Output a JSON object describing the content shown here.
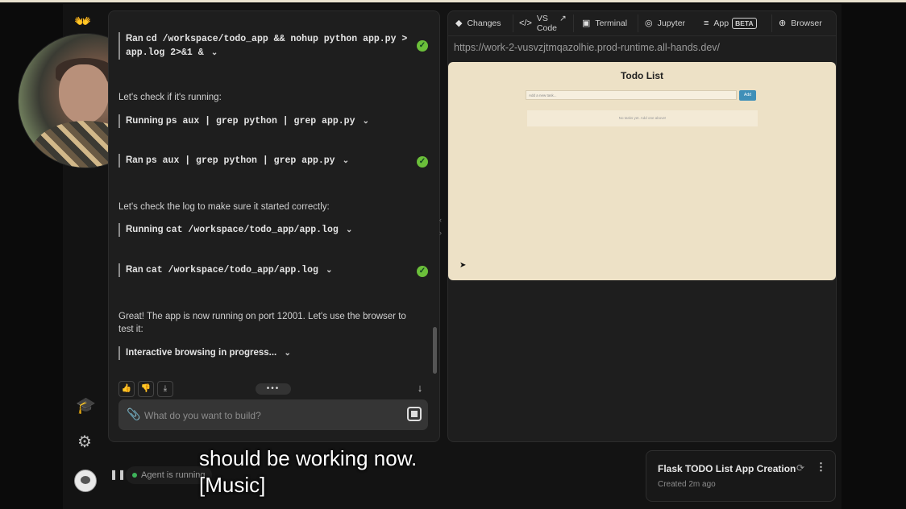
{
  "rail": {
    "logo": "👐"
  },
  "chat": {
    "steps": [
      {
        "kind": "cmd",
        "prefix": "Ran",
        "code": "cd /workspace/todo_app && nohup python app.py >",
        "code2": "app.log 2>&1 &",
        "done": true
      },
      {
        "kind": "text",
        "text": "Let's check if it's running:"
      },
      {
        "kind": "cmd",
        "prefix": "Running",
        "code": "ps aux | grep python | grep app.py",
        "done": false
      },
      {
        "kind": "cmd",
        "prefix": "Ran",
        "code": "ps aux | grep python | grep app.py",
        "done": true
      },
      {
        "kind": "text",
        "text": "Let's check the log to make sure it started correctly:"
      },
      {
        "kind": "cmd",
        "prefix": "Running",
        "code": "cat /workspace/todo_app/app.log",
        "done": false
      },
      {
        "kind": "cmd",
        "prefix": "Ran",
        "code": "cat /workspace/todo_app/app.log",
        "done": true
      },
      {
        "kind": "text",
        "text": "Great! The app is now running on port 12001. Let's use the browser to",
        "text2": "test it:"
      },
      {
        "kind": "status",
        "text": "Interactive browsing in progress..."
      }
    ],
    "composer_placeholder": "What do you want to build?"
  },
  "status_bar": {
    "agent_status": "Agent is running"
  },
  "right": {
    "tabs": [
      {
        "label": "Changes",
        "icon": "git-diamond-icon"
      },
      {
        "label": "VS",
        "label2": "Code",
        "icon": "code-brackets-icon"
      },
      {
        "label": "Terminal",
        "icon": "terminal-icon"
      },
      {
        "label": "Jupyter",
        "icon": "jupyter-icon"
      },
      {
        "label": "App",
        "badge": "BETA",
        "icon": "list-icon"
      },
      {
        "label": "Browser",
        "icon": "globe-icon"
      }
    ],
    "url": "https://work-2-vusvzjtmqazolhie.prod-runtime.all-hands.dev/",
    "viewport": {
      "title": "Todo List",
      "input_placeholder": "Add a new task...",
      "add_button": "Add",
      "empty_text": "No tasks yet. Add one above!"
    }
  },
  "conversation_card": {
    "title": "Flask TODO List App Creation",
    "subtitle": "Created 2m ago"
  },
  "subtitles": {
    "line1": "should be working now.",
    "line2": "[Music]"
  }
}
